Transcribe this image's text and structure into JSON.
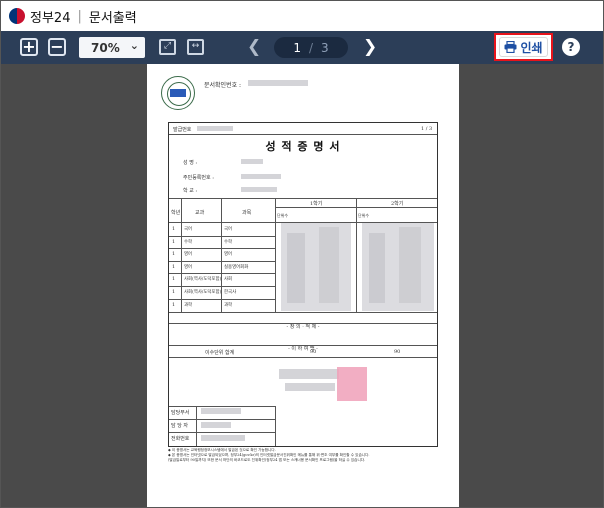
{
  "titlebar": {
    "app_name": "정부24",
    "separator": "|",
    "title": "문서출력"
  },
  "toolbar": {
    "zoom_value": "70%",
    "page_current": "1",
    "page_separator": "/",
    "page_total": "3",
    "print_label": "인쇄",
    "help_label": "?"
  },
  "document": {
    "verify_label": "문서확인번호 :",
    "issue_label": "발급번호",
    "page_indicator": "1 / 3",
    "title": "성 적 증 명 서",
    "fields": {
      "name": "성         명 :",
      "rrn": "주민등록번호 :",
      "school": "학         교 :"
    },
    "table_headers": {
      "grade": "학년",
      "curriculum": "교과",
      "subject": "과목",
      "sem1": "1학기",
      "sem2": "2학기",
      "units": "단위수",
      "achievement": "원점수/과목평균(표준편차)",
      "rank": "석차등급(이수자수)"
    },
    "rows": [
      {
        "grade": "1",
        "curriculum": "국어",
        "subject": "국어"
      },
      {
        "grade": "1",
        "curriculum": "수학",
        "subject": "수학"
      },
      {
        "grade": "1",
        "curriculum": "영어",
        "subject": "영어"
      },
      {
        "grade": "1",
        "curriculum": "영어",
        "subject": "실용영어회화"
      },
      {
        "grade": "1",
        "curriculum": "사회(역사/도덕포함)",
        "subject": "사회"
      },
      {
        "grade": "1",
        "curriculum": "사회(역사/도덕포함)",
        "subject": "한국사"
      },
      {
        "grade": "1",
        "curriculum": "과학",
        "subject": "과학"
      }
    ],
    "section1": "- 창 의 · 적 체 -",
    "section2": "- 이 하 여 백 -",
    "total_label": "이수단위 합계",
    "total_sem1": "90",
    "total_sem2": "90",
    "footer_labels": {
      "dept": "담당부서",
      "person": "담 당 자",
      "phone": "전화번호"
    },
    "notes": [
      "◆ 이 증명서는 교육행정정보시스템에서 발급된 것으로 확인 가능합니다.",
      "◆ 본 증명서는 인터넷으로 발급되었으며, 정부24(gov.kr)의 인터넷발급문서진위확인 메뉴를 통해 위·변조 여부를 확인할 수 있습니다.",
      "  (발급일로부터 90일까지) 또한 문서 하단의 바코드로도 진위확인(정부24 앱 또는 스캐너용 문서확인 프로그램)을 하실 수 있습니다."
    ]
  },
  "colors": {
    "toolbar": "#2c3e58",
    "viewer_bg": "#4a4a4a",
    "print_highlight": "#e8141c",
    "print_text": "#1e4fa3"
  },
  "icons": [
    "government-logo-icon",
    "zoom-in-icon",
    "zoom-out-icon",
    "chevron-down-icon",
    "fit-page-icon",
    "fit-width-icon",
    "prev-page-icon",
    "next-page-icon",
    "printer-icon",
    "help-icon"
  ]
}
